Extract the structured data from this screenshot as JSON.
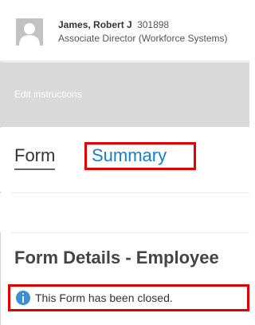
{
  "profile": {
    "name": "James, Robert J",
    "employee_id": "301898",
    "title": "Associate Director (Workforce Systems)"
  },
  "instructions": {
    "link_label": "Edit instructions"
  },
  "tabs": [
    {
      "label": "Form",
      "active": true
    },
    {
      "label": "Summary",
      "active": false,
      "highlighted": true
    }
  ],
  "form_details": {
    "title": "Form Details - Employee"
  },
  "notice": {
    "icon": "info-icon",
    "text": "This Form has been closed."
  },
  "colors": {
    "link_blue": "#1a80c6",
    "highlight_red": "#e00000",
    "info_blue": "#3c8fd0",
    "instructions_bg": "#d9d9d9"
  }
}
